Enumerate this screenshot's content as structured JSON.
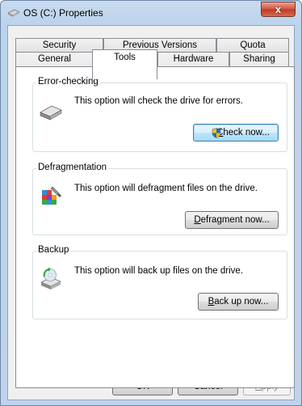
{
  "window": {
    "title": "OS (C:) Properties",
    "close_glyph": "x"
  },
  "tabs_row1": [
    {
      "label": "Security"
    },
    {
      "label": "Previous Versions"
    },
    {
      "label": "Quota"
    }
  ],
  "tabs_row2": [
    {
      "label": "General"
    },
    {
      "label": "Tools"
    },
    {
      "label": "Hardware"
    },
    {
      "label": "Sharing"
    }
  ],
  "selected_tab": "Tools",
  "error_checking": {
    "label": "Error-checking",
    "description": "This option will check the drive for errors.",
    "button_mnemonic": "C",
    "button_rest": "heck now...",
    "icon": "hard-drive-icon"
  },
  "defragmentation": {
    "label": "Defragmentation",
    "description": "This option will defragment files on the drive.",
    "button_mnemonic": "D",
    "button_rest": "efragment now...",
    "icon": "defragment-icon"
  },
  "backup": {
    "label": "Backup",
    "description": "This option will back up files on the drive.",
    "button_mnemonic": "B",
    "button_rest": "ack up now...",
    "icon": "backup-icon"
  },
  "footer": {
    "ok": "OK",
    "cancel": "Cancel",
    "apply_mnemonic": "A",
    "apply_rest": "pply"
  },
  "colors": {
    "accent": "#3c7fb1",
    "shield_blue": "#2f66c4",
    "shield_yellow": "#f2c200"
  }
}
